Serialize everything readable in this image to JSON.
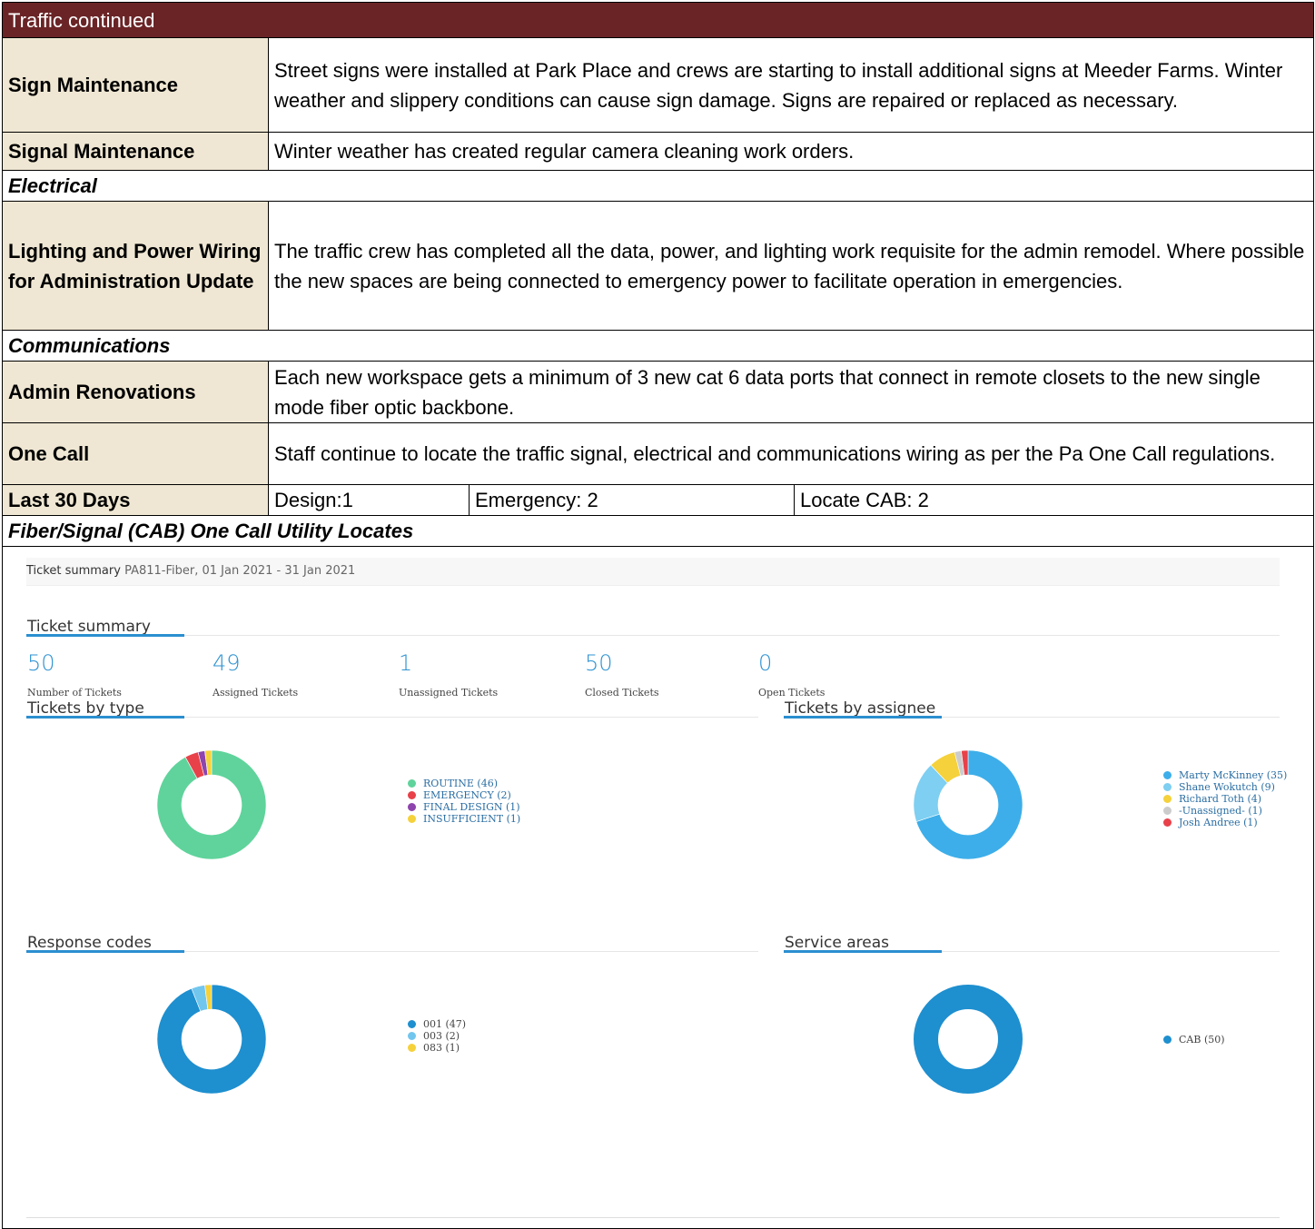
{
  "header": "Traffic continued",
  "rows": {
    "sign": {
      "label": "Sign Maintenance",
      "text": "Street signs were installed at Park Place and crews are starting to install additional signs at Meeder Farms. Winter weather and slippery conditions can cause sign damage. Signs are repaired or replaced as necessary."
    },
    "signal": {
      "label": "Signal Maintenance",
      "text": "Winter weather has created regular camera cleaning work orders."
    },
    "electrical": "Electrical",
    "lighting": {
      "label": "Lighting and Power Wiring for Administration Update",
      "text": "The traffic crew has completed all the data, power, and lighting work requisite for the admin remodel. Where possible the new spaces are being connected to emergency power to facilitate operation in emergencies."
    },
    "communications": "Communications",
    "admin": {
      "label": "Admin Renovations",
      "text": "Each new workspace gets a minimum of 3 new cat 6 data ports that connect in remote closets to the new single mode fiber optic backbone."
    },
    "onecall": {
      "label": "One Call",
      "text": "Staff continue to locate the traffic signal, electrical and communications wiring as per the Pa One Call regulations."
    },
    "last30": {
      "label": "Last 30 Days",
      "design": "Design:1",
      "emergency": "Emergency: 2",
      "locate": "Locate CAB: 2"
    },
    "fiber": "Fiber/Signal (CAB) One Call Utility Locates"
  },
  "dashboard": {
    "bar_title": "Ticket summary",
    "bar_range": "PA811-Fiber, 01 Jan 2021 - 31 Jan 2021",
    "summary_heading": "Ticket summary",
    "stats": [
      {
        "value": "50",
        "label": "Number of Tickets"
      },
      {
        "value": "49",
        "label": "Assigned Tickets"
      },
      {
        "value": "1",
        "label": "Unassigned Tickets"
      },
      {
        "value": "50",
        "label": "Closed Tickets"
      },
      {
        "value": "0",
        "label": "Open Tickets"
      }
    ],
    "type_heading": "Tickets by type",
    "assignee_heading": "Tickets by assignee",
    "response_heading": "Response codes",
    "area_heading": "Service areas"
  },
  "chart_data": [
    {
      "type": "pie",
      "title": "Tickets by type",
      "categories": [
        "ROUTINE (46)",
        "EMERGENCY (2)",
        "FINAL DESIGN (1)",
        "INSUFFICIENT (1)"
      ],
      "values": [
        46,
        2,
        1,
        1
      ],
      "colors": [
        "#5fd39b",
        "#e8414a",
        "#8e44ad",
        "#f5d13b"
      ]
    },
    {
      "type": "pie",
      "title": "Tickets by assignee",
      "categories": [
        "Marty McKinney (35)",
        "Shane Wokutch (9)",
        "Richard Toth (4)",
        "-Unassigned- (1)",
        "Josh Andree (1)"
      ],
      "values": [
        35,
        9,
        4,
        1,
        1
      ],
      "colors": [
        "#3daee9",
        "#7ecff1",
        "#f5d13b",
        "#cccccc",
        "#e8414a"
      ]
    },
    {
      "type": "pie",
      "title": "Response codes",
      "categories": [
        "001 (47)",
        "003 (2)",
        "083 (1)"
      ],
      "values": [
        47,
        2,
        1
      ],
      "colors": [
        "#1e8fcf",
        "#71c6ee",
        "#f5d13b"
      ]
    },
    {
      "type": "pie",
      "title": "Service areas",
      "categories": [
        "CAB (50)"
      ],
      "values": [
        50
      ],
      "colors": [
        "#1e8fcf"
      ]
    }
  ]
}
